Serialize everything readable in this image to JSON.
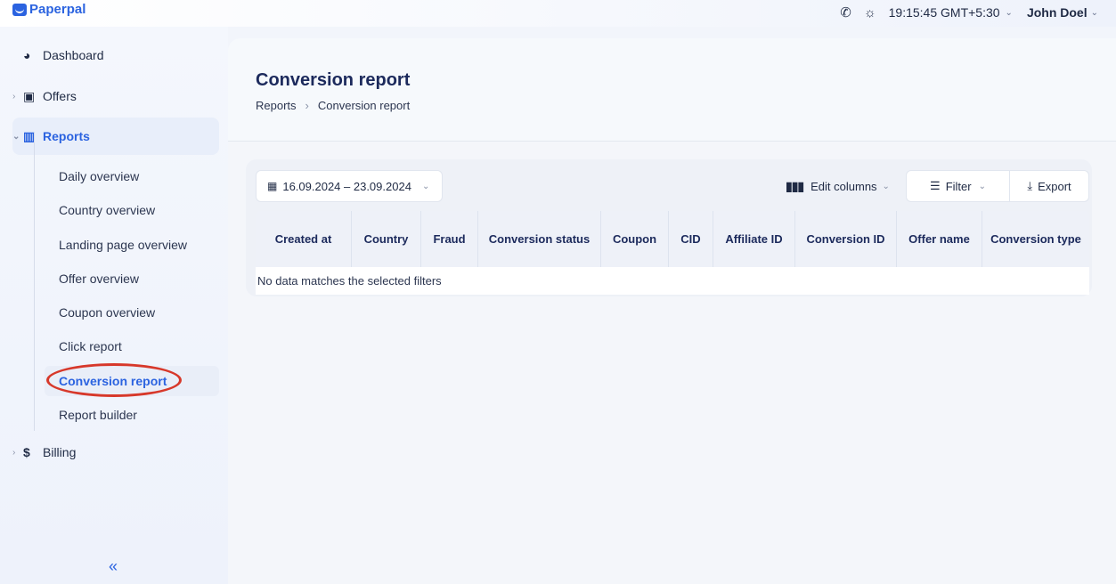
{
  "app": {
    "brand": "Paperpal"
  },
  "topbar": {
    "phone_icon": "phone-icon",
    "theme_icon": "sun-icon",
    "time": "19:15:45 GMT+5:30",
    "user": "John Doel"
  },
  "sidebar": {
    "items": [
      {
        "label": "Dashboard",
        "icon": "pie-chart-icon"
      },
      {
        "label": "Offers",
        "icon": "card-icon"
      },
      {
        "label": "Reports",
        "icon": "chart-icon"
      },
      {
        "label": "Billing",
        "icon": "dollar-icon"
      }
    ],
    "reports_sub": [
      "Daily overview",
      "Country overview",
      "Landing page overview",
      "Offer overview",
      "Coupon overview",
      "Click report",
      "Conversion report",
      "Report builder"
    ],
    "active_sub": "Conversion report",
    "collapse_label": "«"
  },
  "page": {
    "title": "Conversion report",
    "breadcrumb": [
      "Reports",
      "Conversion report"
    ]
  },
  "toolbar": {
    "date_range": "16.09.2024 – 23.09.2024",
    "edit_columns": "Edit columns",
    "filter": "Filter",
    "export": "Export"
  },
  "table": {
    "columns": [
      "Created at",
      "Country",
      "Fraud",
      "Conversion status",
      "Coupon",
      "CID",
      "Affiliate ID",
      "Conversion ID",
      "Offer name",
      "Conversion type"
    ],
    "empty_message": "No data matches the selected filters"
  },
  "colors": {
    "accent": "#2b63e0",
    "title": "#1c2a5c",
    "highlight_ring": "#d7382a"
  }
}
